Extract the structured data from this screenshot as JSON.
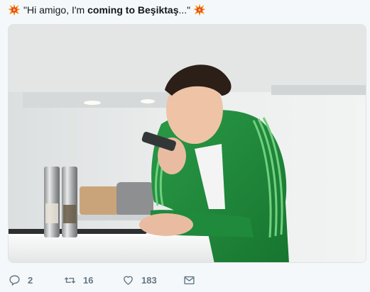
{
  "tweet": {
    "text_start": "\"Hi amigo, I'm ",
    "text_bold": "coming to Beşiktaş",
    "text_end": "...\"",
    "emoji": "collision-emoji"
  },
  "media": {
    "alt": "Man in green track jacket speaking into a phone at a kitchen counter"
  },
  "actions": {
    "replies": "2",
    "retweets": "16",
    "likes": "183"
  },
  "colors": {
    "action_gray": "#657786",
    "jacket_green": "#1f8a3b",
    "stripe_green": "#6fd07f",
    "background": "#f5f8fa"
  }
}
